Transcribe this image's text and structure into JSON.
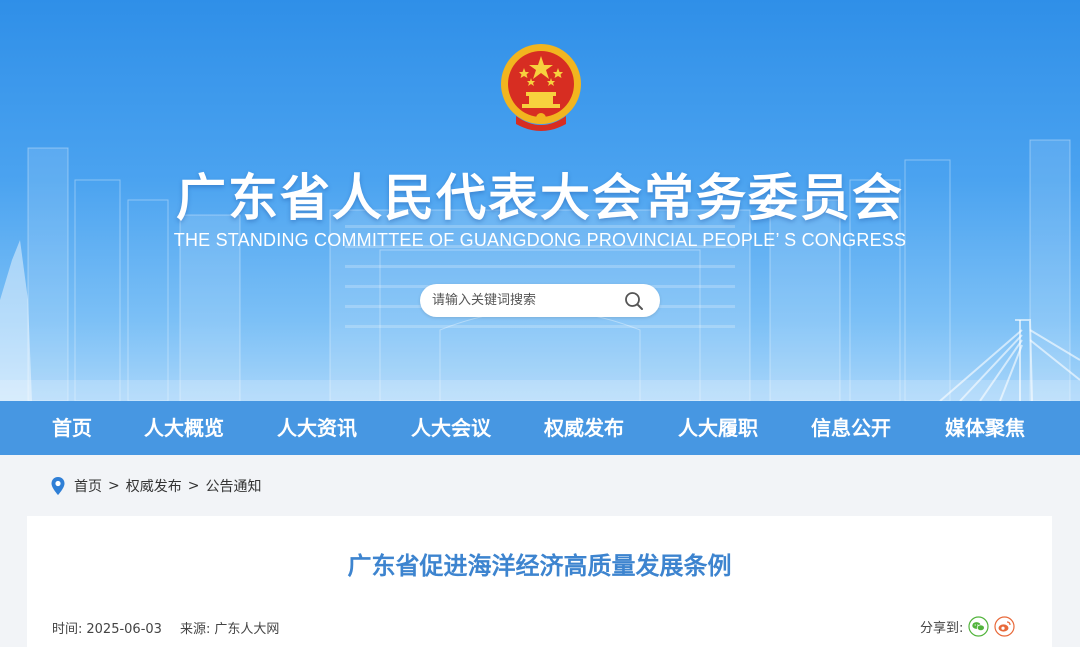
{
  "header": {
    "title": "广东省人民代表大会常务委员会",
    "subtitle": "THE STANDING COMMITTEE OF GUANGDONG PROVINCIAL PEOPLE’ S CONGRESS",
    "emblem_icon": "national-emblem-icon"
  },
  "search": {
    "placeholder": "请输入关键词搜索",
    "value": "",
    "icon": "search-icon"
  },
  "nav": {
    "items": [
      {
        "label": "首页"
      },
      {
        "label": "人大概览"
      },
      {
        "label": "人大资讯"
      },
      {
        "label": "人大会议"
      },
      {
        "label": "权威发布"
      },
      {
        "label": "人大履职"
      },
      {
        "label": "信息公开"
      },
      {
        "label": "媒体聚焦"
      }
    ]
  },
  "breadcrumb": {
    "icon": "location-pin-icon",
    "items": [
      "首页",
      "权威发布",
      "公告通知"
    ],
    "separator": ">"
  },
  "article": {
    "title": "广东省促进海洋经济高质量发展条例",
    "time_label": "时间:",
    "time_value": "2025-06-03",
    "source_label": "来源:",
    "source_value": "广东人大网",
    "share_label": "分享到:",
    "share_icons": [
      "wechat-icon",
      "weibo-icon"
    ]
  },
  "colors": {
    "header_top": "#2f8fe8",
    "nav_bg": "#4797e2",
    "title_blue": "#3d84cf",
    "page_bg": "#f2f4f7",
    "wechat_green": "#52b43c",
    "weibo_orange": "#e8693a"
  }
}
